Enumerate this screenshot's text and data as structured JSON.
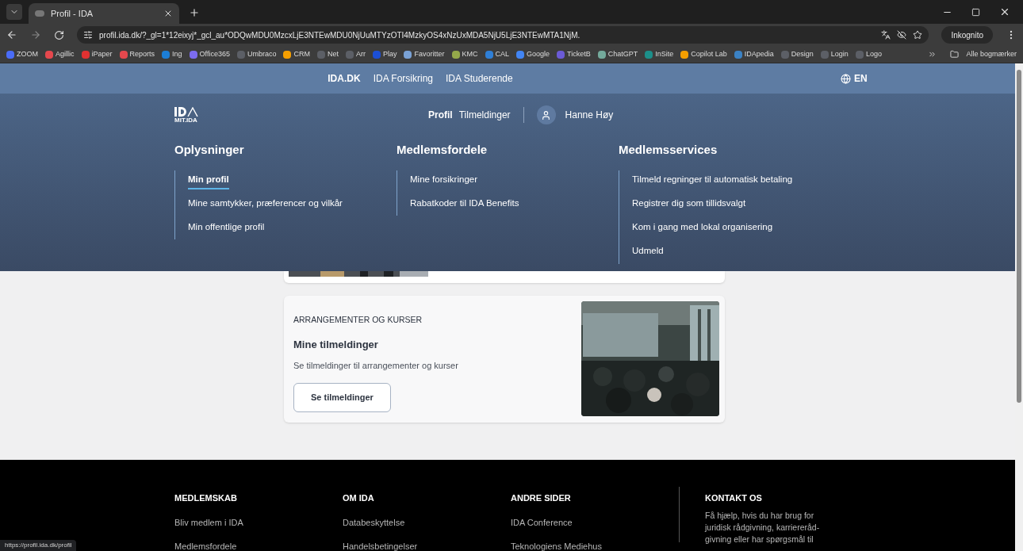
{
  "browser": {
    "tab_title": "Profil - IDA",
    "url": "profil.ida.dk/?_gl=1*12eixyj*_gcl_au*ODQwMDU0MzcxLjE3NTEwMDU0NjUuMTYzOTI4MzkyOS4xNzUxMDA5NjU5LjE3NTEwMTA1NjM.",
    "incognito": "Inkognito",
    "all_bookmarks": "Alle bogmærker",
    "bookmarks": [
      {
        "label": "ZOOM",
        "color": "#4a6cf7"
      },
      {
        "label": "Agillic",
        "color": "#e5484d"
      },
      {
        "label": "iPaper",
        "color": "#e03131"
      },
      {
        "label": "Reports",
        "color": "#e5484d"
      },
      {
        "label": "Ing",
        "color": "#1c7ed6"
      },
      {
        "label": "Office365",
        "color": "#7c6cf0"
      },
      {
        "label": "Umbraco",
        "color": "#5c5f66"
      },
      {
        "label": "CRM",
        "color": "#f59f00"
      },
      {
        "label": "Net",
        "color": "#5c5f66"
      },
      {
        "label": "Arr",
        "color": "#5c5f66"
      },
      {
        "label": "Play",
        "color": "#1c4fd6"
      },
      {
        "label": "Favoritter",
        "color": "#7aa2d6"
      },
      {
        "label": "KMC",
        "color": "#94a84a"
      },
      {
        "label": "CAL",
        "color": "#2f7fd6"
      },
      {
        "label": "Google",
        "color": "#4285f4"
      },
      {
        "label": "TicketB",
        "color": "#6b5bd6"
      },
      {
        "label": "ChatGPT",
        "color": "#74aa9c"
      },
      {
        "label": "InSite",
        "color": "#1c8f8a"
      },
      {
        "label": "Copilot Lab",
        "color": "#f59f00"
      },
      {
        "label": "IDApedia",
        "color": "#3b82c4"
      },
      {
        "label": "Design",
        "color": "#5c5f66"
      },
      {
        "label": "Login",
        "color": "#5c5f66"
      },
      {
        "label": "Logo",
        "color": "#5c5f66"
      }
    ],
    "status_url": "https://profil.ida.dk/profil"
  },
  "top_nav": {
    "items": [
      {
        "label": "IDA.DK",
        "selected": true
      },
      {
        "label": "IDA Forsikring",
        "selected": false
      },
      {
        "label": "IDA Studerende",
        "selected": false
      }
    ],
    "language": "EN"
  },
  "header": {
    "logo_subtitle": "MIT.IDA",
    "nav": [
      {
        "label": "Profil",
        "selected": true
      },
      {
        "label": "Tilmeldinger",
        "selected": false
      }
    ],
    "user": "Hanne Høy"
  },
  "menu": [
    {
      "heading": "Oplysninger",
      "items": [
        {
          "label": "Min profil",
          "selected": true
        },
        {
          "label": "Mine samtykker, præferencer og vilkår",
          "selected": false
        },
        {
          "label": "Min offentlige profil",
          "selected": false
        }
      ]
    },
    {
      "heading": "Medlemsfordele",
      "items": [
        {
          "label": "Mine forsikringer",
          "selected": false
        },
        {
          "label": "Rabatkoder til IDA Benefits",
          "selected": false
        }
      ]
    },
    {
      "heading": "Medlemsservices",
      "items": [
        {
          "label": "Tilmeld regninger til automatisk betaling",
          "selected": false
        },
        {
          "label": "Registrer dig som tillidsvalgt",
          "selected": false
        },
        {
          "label": "Kom i gang med lokal organisering",
          "selected": false
        },
        {
          "label": "Udmeld",
          "selected": false
        }
      ]
    }
  ],
  "card": {
    "eyebrow": "ARRANGEMENTER OG KURSER",
    "title": "Mine tilmeldinger",
    "text": "Se tilmeldinger til arrangementer og kurser",
    "button": "Se tilmeldinger"
  },
  "footer": {
    "columns": [
      {
        "heading": "MEDLEMSKAB",
        "links": [
          "Bliv medlem i IDA",
          "Medlemsfordele"
        ]
      },
      {
        "heading": "OM IDA",
        "links": [
          "Databeskyttelse",
          "Handelsbetingelser"
        ]
      },
      {
        "heading": "ANDRE SIDER",
        "links": [
          "IDA Conference",
          "Teknologiens Mediehus"
        ]
      }
    ],
    "contact": {
      "heading": "KONTAKT OS",
      "lines": [
        "Få hjælp, hvis du har brug for",
        "juridisk rådgivning, karrierеråd-",
        "givning eller har spørgsmål til"
      ]
    }
  }
}
